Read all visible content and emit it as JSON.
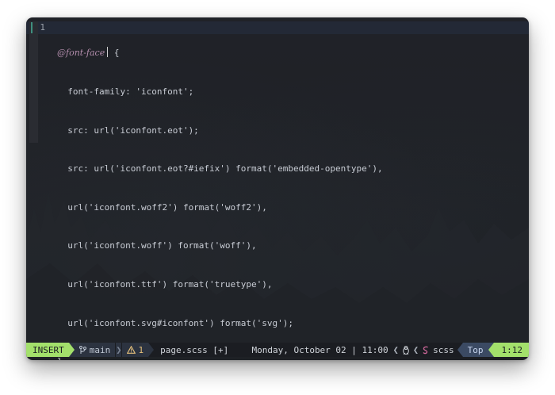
{
  "editor": {
    "line_number": "1",
    "lines": [
      {
        "keyword": "@font-face",
        "rest": " {"
      },
      {
        "text": "  font-family: 'iconfont';"
      },
      {
        "text": "  src: url('iconfont.eot');"
      },
      {
        "text": "  src: url('iconfont.eot?#iefix') format('embedded-opentype'),"
      },
      {
        "text": "  url('iconfont.woff2') format('woff2'),"
      },
      {
        "text": "  url('iconfont.woff') format('woff'),"
      },
      {
        "text": "  url('iconfont.ttf') format('truetype'),"
      },
      {
        "text": "  url('iconfont.svg#iconfont') format('svg');"
      },
      {
        "text": "}"
      }
    ]
  },
  "statusline": {
    "mode": "INSERT",
    "branch_icon": "git-branch-icon",
    "branch": "main",
    "warning_icon": "warning-triangle-icon",
    "warnings": "1",
    "filename": "page.scss [+]",
    "datetime": "Monday, October 02 | 11:00",
    "os_icon": "linux-penguin-icon",
    "filetype_icon": "sass-icon",
    "filetype": "scss",
    "scroll": "Top",
    "position": "1:12"
  },
  "colors": {
    "mode_bg": "#a3e06b",
    "segment_bg": "#2c3340",
    "scroll_bg": "#3b4a63",
    "keyword": "#b48ead",
    "warning": "#e5c07b",
    "sass": "#cd6799"
  }
}
